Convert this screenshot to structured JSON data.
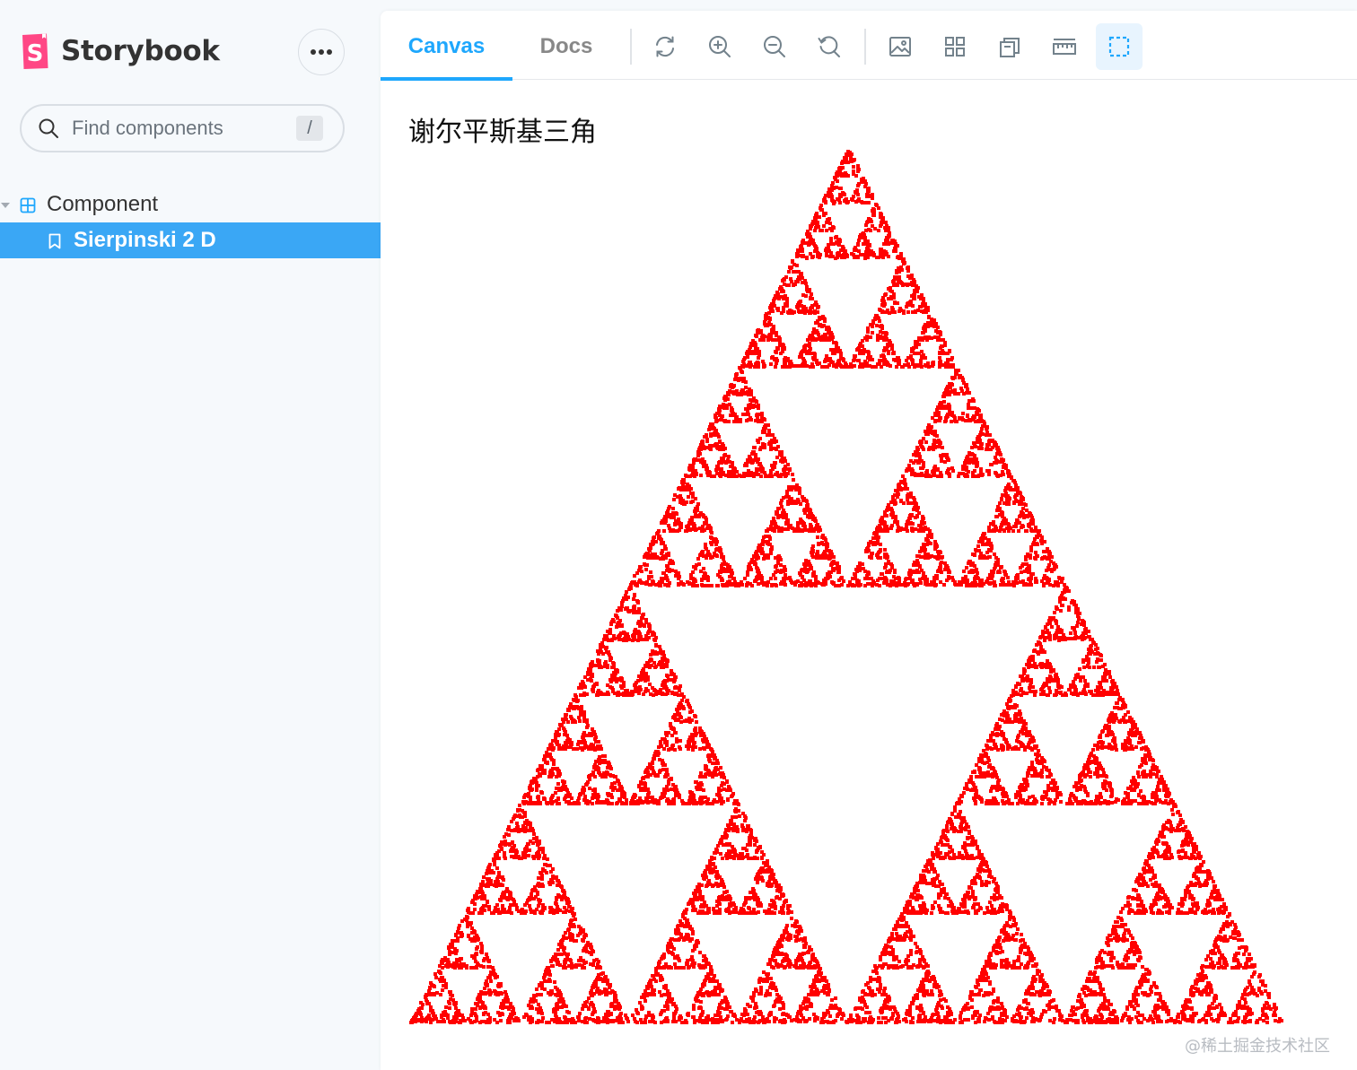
{
  "sidebar": {
    "brand": "Storybook",
    "search": {
      "placeholder": "Find components",
      "shortcut": "/"
    },
    "tree": {
      "group_label": "Component",
      "item_label": "Sierpinski 2 D"
    }
  },
  "toolbar": {
    "tabs": [
      {
        "label": "Canvas",
        "active": true
      },
      {
        "label": "Docs",
        "active": false
      }
    ],
    "tools": [
      "reload-icon",
      "zoom-in-icon",
      "zoom-out-icon",
      "zoom-reset-icon",
      "background-icon",
      "grid-icon",
      "viewport-icon",
      "measure-icon",
      "outline-icon"
    ]
  },
  "canvas": {
    "title": "谢尔平斯基三角",
    "fractal_color": "#ff0000",
    "watermark": "@稀土掘金技术社区"
  },
  "colors": {
    "accent": "#1ea7fd",
    "selected_bg": "#3aa7f5",
    "brand_pink": "#ff4785"
  }
}
